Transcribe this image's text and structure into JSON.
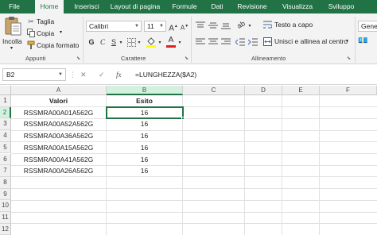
{
  "tabs": [
    "File",
    "Home",
    "Inserisci",
    "Layout di pagina",
    "Formule",
    "Dati",
    "Revisione",
    "Visualizza",
    "Sviluppo"
  ],
  "ribbon": {
    "clipboard": {
      "paste": "Incolla",
      "cut": "Taglia",
      "copy": "Copia",
      "format_painter": "Copia formato",
      "group": "Appunti"
    },
    "font": {
      "name": "Calibri",
      "size": "11",
      "group": "Carattere"
    },
    "alignment": {
      "wrap": "Testo a capo",
      "merge": "Unisci e allinea al centro",
      "group": "Allineamento"
    },
    "number": {
      "format": "Genera"
    }
  },
  "formula_bar": {
    "name_box": "B2",
    "cancel": "✕",
    "enter": "✓",
    "fx": "fx",
    "formula": "=LUNGHEZZA($A2)"
  },
  "grid": {
    "columns": [
      "A",
      "B",
      "C",
      "D",
      "E",
      "F"
    ],
    "rows": [
      "1",
      "2",
      "3",
      "4",
      "5",
      "6",
      "7",
      "8",
      "9",
      "10",
      "11",
      "12"
    ],
    "header": {
      "a": "Valori",
      "b": "Esito"
    },
    "data": [
      {
        "a": "RSSMRA00A01A562G",
        "b": "16"
      },
      {
        "a": "RSSMRA00A52A562G",
        "b": "16"
      },
      {
        "a": "RSSMRA00A36A562G",
        "b": "16"
      },
      {
        "a": "RSSMRA00A15A562G",
        "b": "16"
      },
      {
        "a": "RSSMRA00A41A562G",
        "b": "16"
      },
      {
        "a": "RSSMRA00A26A562G",
        "b": "16"
      }
    ]
  },
  "colors": {
    "excel_green": "#217346",
    "ribbon_bg": "#f3f3f3",
    "selection_header": "#d3f0e0"
  }
}
